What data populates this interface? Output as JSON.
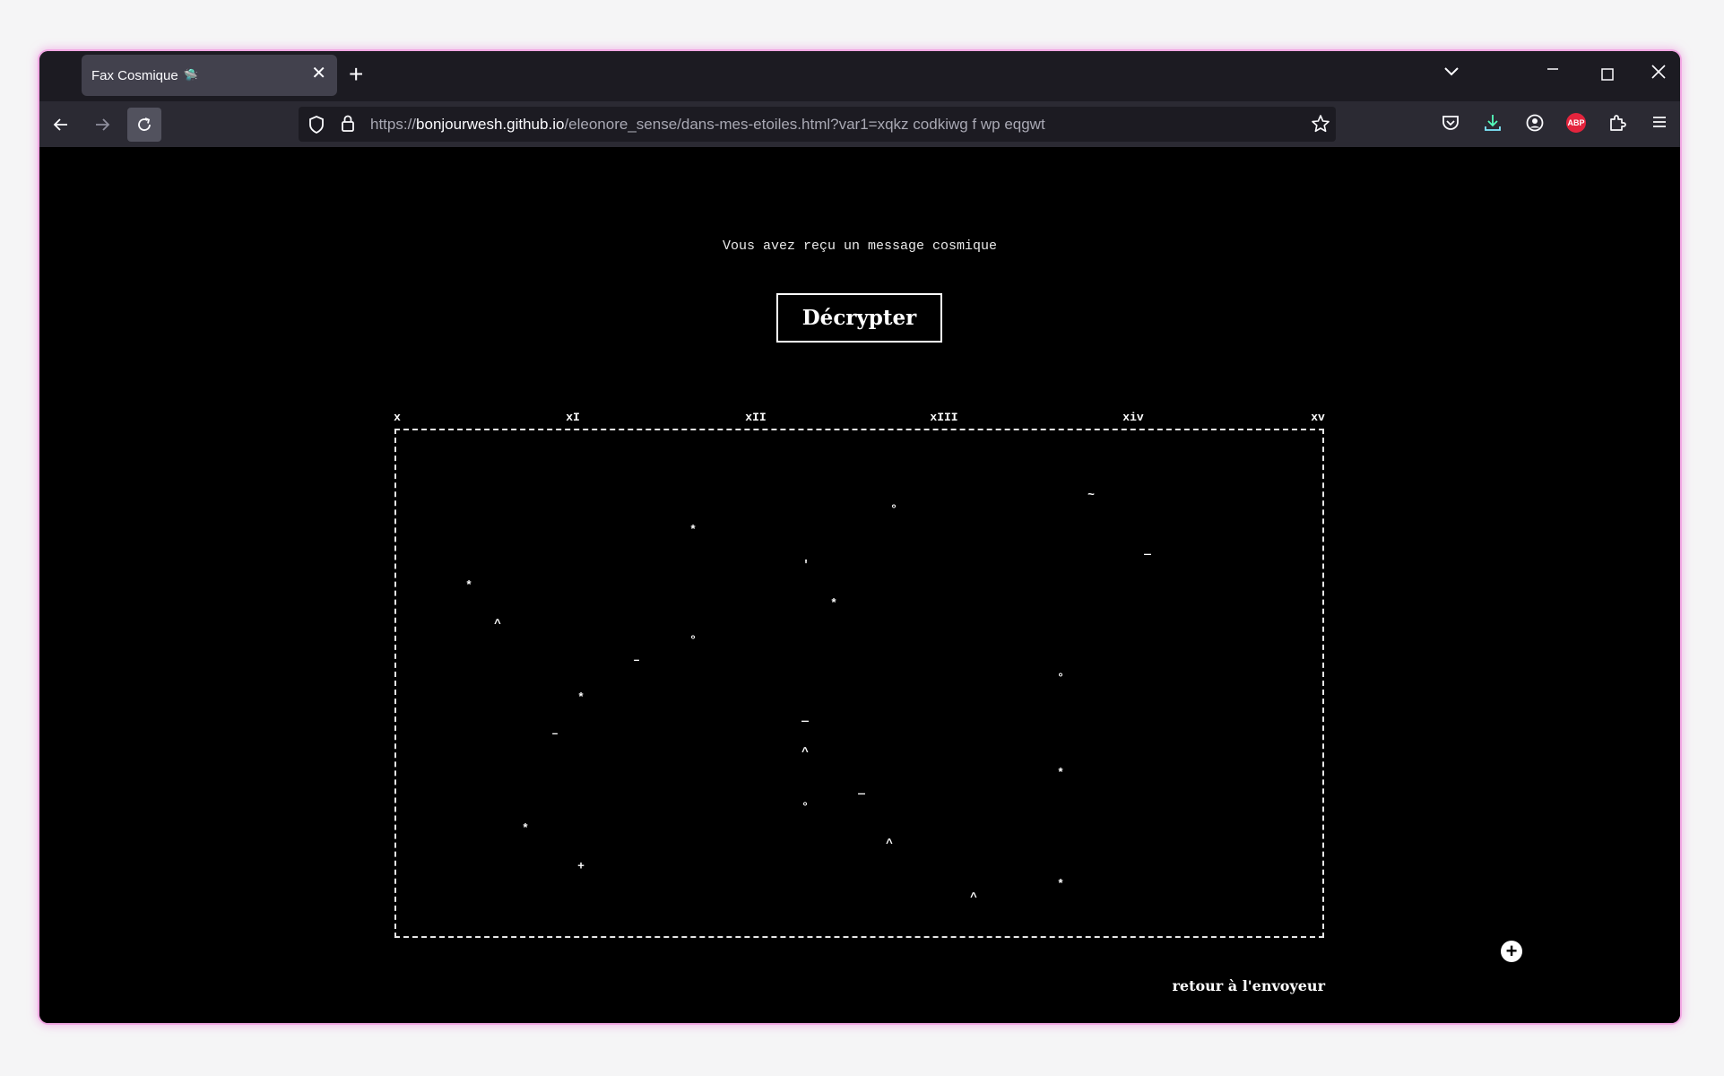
{
  "browser": {
    "tab": {
      "title": "Fax Cosmique",
      "emoji": "🛸"
    },
    "url": {
      "scheme": "https://",
      "host": "bonjourwesh.github.io",
      "path": "/eleonore_sense/dans-mes-etoiles.html?var1=xqkz codkiwg f wp eqgwt"
    },
    "extensions": {
      "abp_label": "ABP"
    }
  },
  "page": {
    "subtitle": "Vous avez reçu un message cosmique",
    "decrypt_label": "Décrypter",
    "ruler_labels": [
      "x",
      "xI",
      "xII",
      "xIII",
      "xiv",
      "xv"
    ],
    "return_label": "retour à l'envoyeur",
    "plus_label": "+"
  },
  "stars": [
    {
      "c": "~"
    },
    {
      "c": "°"
    },
    {
      "c": "*"
    },
    {
      "c": "—"
    },
    {
      "c": "'"
    },
    {
      "c": "*"
    },
    {
      "c": "*"
    },
    {
      "c": "^"
    },
    {
      "c": "°"
    },
    {
      "c": "–"
    },
    {
      "c": "°"
    },
    {
      "c": "*"
    },
    {
      "c": "—"
    },
    {
      "c": "–"
    },
    {
      "c": "^"
    },
    {
      "c": "*"
    },
    {
      "c": "—"
    },
    {
      "c": "°"
    },
    {
      "c": "*"
    },
    {
      "c": "^"
    },
    {
      "c": "+"
    },
    {
      "c": "*"
    },
    {
      "c": "^"
    }
  ]
}
